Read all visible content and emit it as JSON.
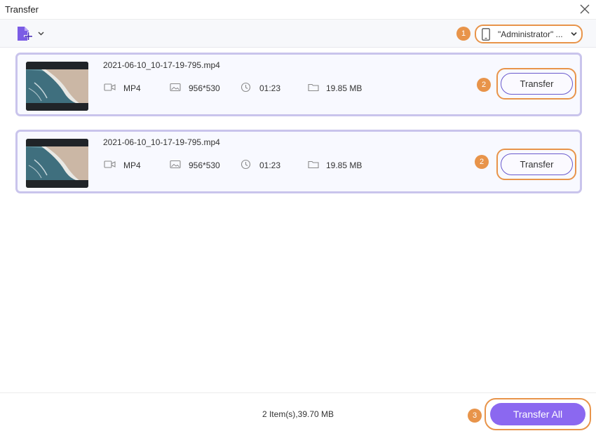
{
  "window": {
    "title": "Transfer",
    "close_icon": "close-icon"
  },
  "toolbar": {
    "add_icon": "add-file-icon",
    "device_select": {
      "value": "\"Administrator\" ...",
      "marker": "1"
    }
  },
  "files": [
    {
      "name": "2021-06-10_10-17-19-795.mp4",
      "format": "MP4",
      "resolution": "956*530",
      "duration": "01:23",
      "size": "19.85 MB",
      "transfer_label": "Transfer",
      "marker": "2"
    },
    {
      "name": "2021-06-10_10-17-19-795.mp4",
      "format": "MP4",
      "resolution": "956*530",
      "duration": "01:23",
      "size": "19.85 MB",
      "transfer_label": "Transfer",
      "marker": "2"
    }
  ],
  "footer": {
    "summary": "2 Item(s),39.70 MB",
    "transfer_all_label": "Transfer All",
    "marker": "3"
  },
  "colors": {
    "accent": "#8b68f0",
    "highlight": "#e8944a",
    "item_border": "#c9c4ec",
    "button_border": "#6a5acd"
  }
}
